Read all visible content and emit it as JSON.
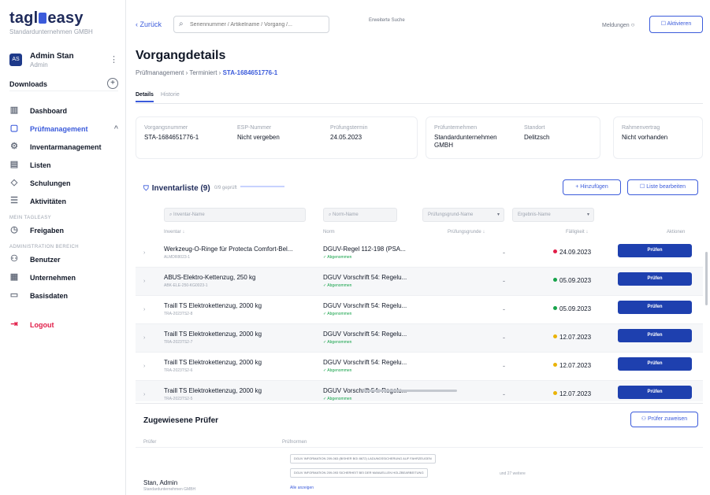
{
  "logo": {
    "text_left": "tagl",
    "text_right": "easy",
    "subtitle": "Standardunternehmen GMBH"
  },
  "user": {
    "name": "Admin Stan",
    "role": "Admin",
    "initials": "AS",
    "menu": "⋮"
  },
  "downloads": {
    "label": "Downloads",
    "plus": "+"
  },
  "sidebar": {
    "items": [
      {
        "label": "Dashboard",
        "icon": "bar-chart-icon",
        "glyph": "▥"
      },
      {
        "label": "Prüfmanagement",
        "icon": "clipboard-icon",
        "glyph": "▢",
        "active": true,
        "chevron": "^"
      },
      {
        "label": "Inventarmanagement",
        "icon": "settings-icon",
        "glyph": "⚙"
      },
      {
        "label": "Listen",
        "icon": "list-icon",
        "glyph": "▤"
      },
      {
        "label": "Schulungen",
        "icon": "graduation-icon",
        "glyph": "◇"
      },
      {
        "label": "Aktivitäten",
        "icon": "activity-icon",
        "glyph": "☰"
      }
    ],
    "section1": "MEIN TAGLEASY",
    "freigaben": {
      "label": "Freigaben",
      "icon": "clock-icon",
      "glyph": "◷"
    },
    "section2": "ADMINISTRATION BEREICH",
    "admin_items": [
      {
        "label": "Benutzer",
        "icon": "users-icon",
        "glyph": "⚇"
      },
      {
        "label": "Unternehmen",
        "icon": "building-icon",
        "glyph": "▦"
      },
      {
        "label": "Basisdaten",
        "icon": "folder-icon",
        "glyph": "▭"
      }
    ],
    "logout": {
      "label": "Logout",
      "icon": "logout-icon",
      "glyph": "⇥"
    }
  },
  "topbar": {
    "back": "‹ Zurück",
    "search_placeholder": "Seriennummer / Artikelname / Vorgang /...",
    "ext_search": "Erweiterte Suche",
    "notify": "Meldungen",
    "activate": "Aktivieren"
  },
  "page": {
    "title": "Vorgangdetails",
    "crumb_path": "Prüfmanagement › Terminiert › ",
    "crumb_current": "STA-1684651776-1",
    "tabs": [
      "Details",
      "Historie"
    ]
  },
  "info1": [
    {
      "label": "Vorgangsnummer",
      "value": "STA-1684651776-1"
    },
    {
      "label": "ESP-Nummer",
      "value": "Nicht vergeben"
    },
    {
      "label": "Prüfungstermin",
      "value": "24.05.2023"
    }
  ],
  "info2": [
    {
      "label": "Prüfunternehmen",
      "value": "Standardunternehmen GMBH"
    },
    {
      "label": "Standort",
      "value": "Delitzsch"
    }
  ],
  "info3": [
    {
      "label": "Rahmenvertrag",
      "value": "Nicht vorhanden"
    }
  ],
  "inventar": {
    "title": "Inventarliste (9)",
    "meta": "0/9 geprüft",
    "add": "+ Hinzufügen",
    "edit": "Liste bearbeiten",
    "filters": [
      "Inventar-Name",
      "Norm-Name",
      "Prüfungsgrund-Name",
      "Ergebnis-Name"
    ],
    "headers": [
      "Inventar ↓",
      "Norm",
      "Prüfungsgrunde ↓",
      "Fälligkeit ↓",
      "Aktionen"
    ],
    "rows": [
      {
        "name": "Werkzeug-O-Ringe für Protecta Comfort-Bel...",
        "code": "ALMDR8023-1",
        "norm": "DGUV-Regel 112-198 (PSA...",
        "status": "✓ Abgenommen",
        "grund": "-",
        "date": "24.09.2023",
        "dot": "#e11d48",
        "btn": "Prüfen"
      },
      {
        "name": "ABUS-Elektro-Kettenzug, 250 kg",
        "code": "ABK-ELE-250-KG0023-1",
        "norm": "DGUV Vorschrift 54: Regelu...",
        "status": "✓ Abgenommen",
        "grund": "-",
        "date": "05.09.2023",
        "dot": "#16a34a",
        "btn": "Prüfen"
      },
      {
        "name": "Traill TS Elektrokettenzug, 2000 kg",
        "code": "TRA-2023TS2-8",
        "norm": "DGUV Vorschrift 54: Regelu...",
        "status": "✓ Abgenommen",
        "grund": "-",
        "date": "05.09.2023",
        "dot": "#16a34a",
        "btn": "Prüfen"
      },
      {
        "name": "Traill TS Elektrokettenzug, 2000 kg",
        "code": "TRA-2023TS2-7",
        "norm": "DGUV Vorschrift 54: Regelu...",
        "status": "✓ Abgenommen",
        "grund": "-",
        "date": "12.07.2023",
        "dot": "#eab308",
        "btn": "Prüfen"
      },
      {
        "name": "Traill TS Elektrokettenzug, 2000 kg",
        "code": "TRA-2023TS2-6",
        "norm": "DGUV Vorschrift 54: Regelu...",
        "status": "✓ Abgenommen",
        "grund": "-",
        "date": "12.07.2023",
        "dot": "#eab308",
        "btn": "Prüfen"
      },
      {
        "name": "Traill TS Elektrokettenzug, 2000 kg",
        "code": "TRA-2023TS2-5",
        "norm": "DGUV Vorschrift 54: Regelu...",
        "status": "✓ Abgenommen",
        "grund": "-",
        "date": "12.07.2023",
        "dot": "#eab308",
        "btn": "Prüfen"
      }
    ]
  },
  "pruefer": {
    "title": "Zugewiesene Prüfer",
    "add": "Prüfer zuweisen",
    "col_name": "Prüfer",
    "col_quali": "Prüfnormen",
    "name": "Stan, Admin",
    "org": "Standardunternehmen GMBH",
    "tags": [
      "DGUV INFORMATION 209-063 (BISHER BGI 8672) LADUNGSSICHERUNG AUF FAHRZEUGEN",
      "DGUV INFORMATION 209-093 SICHERHEIT BEI DER MANUELLEN HOLZBEARBEITUNG"
    ],
    "more": "und 27 weitere",
    "link": "Alle anzeigen"
  }
}
